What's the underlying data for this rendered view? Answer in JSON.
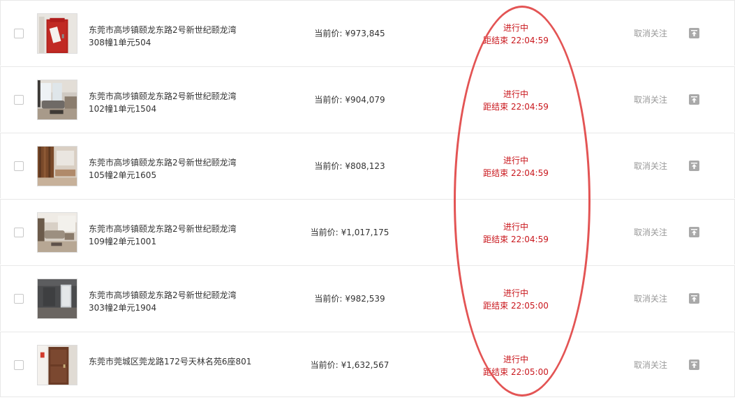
{
  "items": [
    {
      "title": "东莞市高埗镇颐龙东路2号新世纪颐龙湾\n308幢1单元504",
      "price_label": "当前价:",
      "price": "¥973,845",
      "status": "进行中",
      "countdown": "距结束 22:04:59",
      "unfollow": "取消关注",
      "thumb": "door-sign"
    },
    {
      "title": "东莞市高埗镇颐龙东路2号新世纪颐龙湾\n102幢1单元1504",
      "price_label": "当前价:",
      "price": "¥904,079",
      "status": "进行中",
      "countdown": "距结束 22:04:59",
      "unfollow": "取消关注",
      "thumb": "living-room"
    },
    {
      "title": "东莞市高埗镇颐龙东路2号新世纪颐龙湾\n105幢2单元1605",
      "price_label": "当前价:",
      "price": "¥808,123",
      "status": "进行中",
      "countdown": "距结束 22:04:59",
      "unfollow": "取消关注",
      "thumb": "wood-wall"
    },
    {
      "title": "东莞市高埗镇颐龙东路2号新世纪颐龙湾\n109幢2单元1001",
      "price_label": "当前价:",
      "price": "¥1,017,175",
      "status": "进行中",
      "countdown": "距结束 22:04:59",
      "unfollow": "取消关注",
      "thumb": "sofa-room"
    },
    {
      "title": "东莞市高埗镇颐龙东路2号新世纪颐龙湾\n303幢2单元1904",
      "price_label": "当前价:",
      "price": "¥982,539",
      "status": "进行中",
      "countdown": "距结束 22:05:00",
      "unfollow": "取消关注",
      "thumb": "empty-room"
    },
    {
      "title": "东莞市莞城区莞龙路172号天林名苑6座801",
      "price_label": "当前价:",
      "price": "¥1,632,567",
      "status": "进行中",
      "countdown": "距结束 22:05:00",
      "unfollow": "取消关注",
      "thumb": "brown-door"
    }
  ],
  "colors": {
    "status": "#c9171d",
    "annotation": "#e35454",
    "muted": "#999999",
    "top_button": "#a9a9a9"
  },
  "icons": {
    "checkbox": "checkbox-icon",
    "pin_top": "pin-top-icon"
  }
}
